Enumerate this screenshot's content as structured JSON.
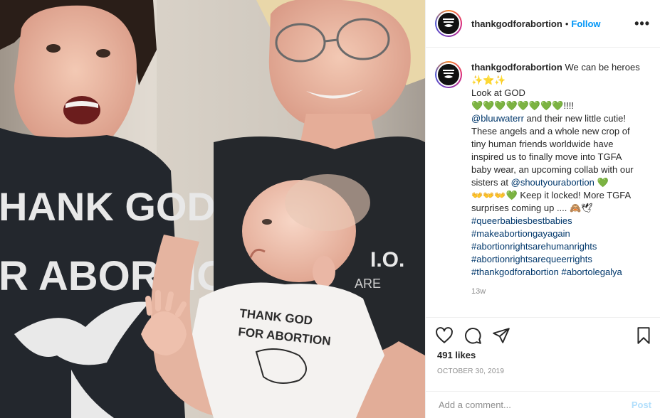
{
  "header": {
    "username": "thankgodforabortion",
    "separator": "•",
    "follow_label": "Follow",
    "more_label": "•••"
  },
  "photo": {
    "shirt_left_text_1": "HANK GOD",
    "shirt_left_text_2": "R ABORTION",
    "onesie_text_1": "THANK GOD",
    "onesie_text_2": "FOR ABORTION",
    "shirt_right_text": "I.O.",
    "shirt_right_text_2": "ARE"
  },
  "caption": {
    "username": "thankgodforabortion",
    "line1": " We can be heroes ",
    "sparkles": "✨⭐✨",
    "line2": "Look at GOD",
    "hearts": "💚💚💚💚💚💚💚💚",
    "exclaims": "!!!!",
    "mention1": "@bluuwaterr",
    "body1": " and their new little cutie! These angels and a whole new crop of tiny human friends worldwide have inspired us to finally move into TGFA baby wear, an upcoming collab with our sisters at ",
    "mention2": "@shoutyourabortion",
    "heart_single": " 💚",
    "hands": "👐👐👐💚",
    "body2": " Keep it locked! More TGFA surprises coming up .... ",
    "end_emoji": "🙈🕊",
    "hashtags": [
      "#queerbabiesbestbabies",
      "#makeabortiongayagain",
      "#abortionrightsarehumanrights",
      "#abortionrightsarequeerrights"
    ],
    "hashtag_last_a": "#thankgodforabortion",
    "hashtag_last_b": "#abortolegalya",
    "time_ago": "13w"
  },
  "actions": {
    "like_icon": "heart-icon",
    "comment_icon": "comment-icon",
    "share_icon": "paper-plane-icon",
    "save_icon": "bookmark-icon"
  },
  "likes": "491 likes",
  "date": "OCTOBER 30, 2019",
  "comment": {
    "placeholder": "Add a comment...",
    "post_label": "Post"
  },
  "colors": {
    "accent": "#0095f6",
    "link": "#00376b",
    "heart_green": "#22b02a",
    "muted": "#8e8e8e"
  }
}
